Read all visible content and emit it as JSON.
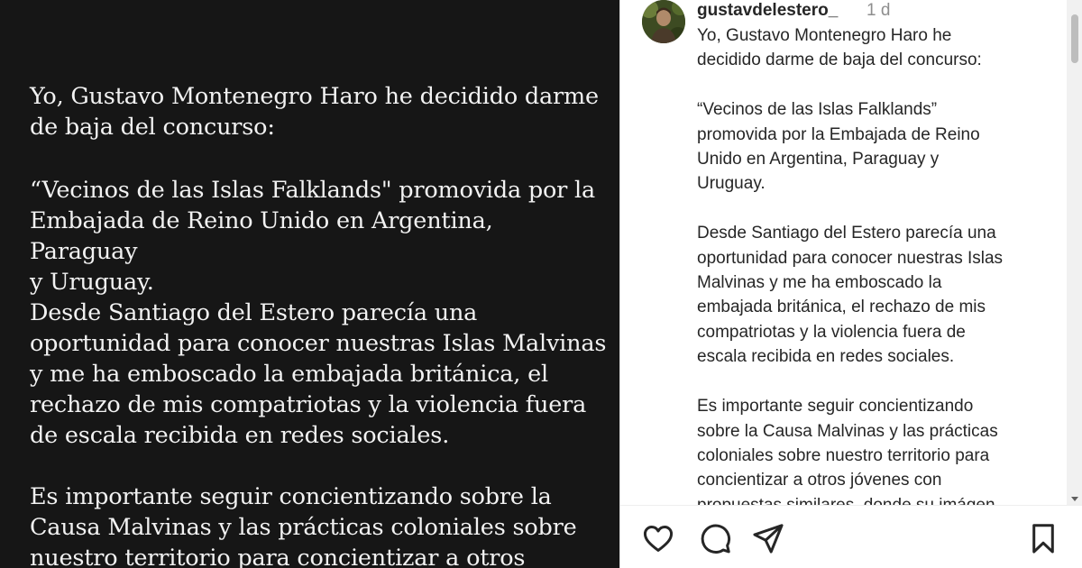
{
  "post_image": {
    "paragraphs": [
      "Yo, Gustavo Montenegro Haro he decidido darme\nde baja del concurso:",
      "“Vecinos de las Islas Falklands\" promovida por la\nEmbajada de Reino Unido en Argentina, Paraguay\ny Uruguay.",
      "Desde Santiago del Estero parecía una\noportunidad para conocer nuestras Islas Malvinas\ny me ha emboscado la embajada británica, el\nrechazo de mis compatriotas y la violencia fuera\nde escala recibida en redes sociales.",
      "Es importante seguir concientizando sobre la\nCausa Malvinas y las prácticas coloniales sobre\nnuestro territorio para concientizar a otros"
    ]
  },
  "post": {
    "username": "gustavdelestero_",
    "timestamp": "1 d",
    "caption": "Yo, Gustavo Montenegro Haro he\ndecidido darme de baja del concurso:\n\n“Vecinos de las Islas Falklands”\npromovida por la Embajada de Reino\nUnido en Argentina, Paraguay y\nUruguay.\n\nDesde Santiago del Estero parecía una\noportunidad para conocer nuestras Islas\nMalvinas y me ha emboscado la\nembajada británica, el rechazo de mis\ncompatriotas y la violencia fuera de\nescala recibida en redes sociales.\n\nEs importante seguir concientizando\nsobre la Causa Malvinas y las prácticas\ncoloniales sobre nuestro territorio para\nconcientizar a otros jóvenes con\npropuestas similares, donde su imágen"
  },
  "actions": {
    "like_icon": "heart-outline-icon",
    "comment_icon": "comment-bubble-icon",
    "share_icon": "paper-plane-icon",
    "save_icon": "bookmark-outline-icon"
  },
  "colors": {
    "image_background": "#161616",
    "image_text": "#f2f2f2",
    "username": "#262626",
    "timestamp": "#8e8e8e"
  }
}
